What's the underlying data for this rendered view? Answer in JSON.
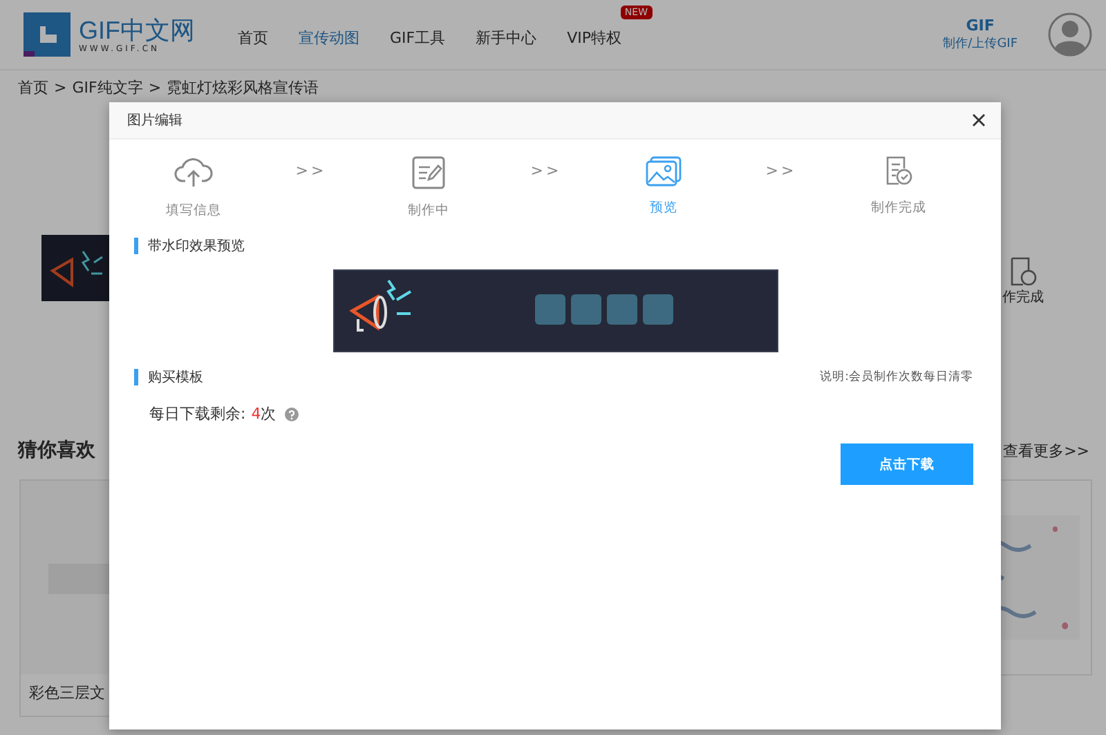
{
  "header": {
    "logo_text": "GIF中文网",
    "logo_sub": "WWW.GIF.CN",
    "nav": [
      {
        "label": "首页",
        "selected": false
      },
      {
        "label": "宣传动图",
        "selected": true
      },
      {
        "label": "GIF工具",
        "selected": false
      },
      {
        "label": "新手中心",
        "selected": false
      },
      {
        "label": "VIP特权",
        "selected": false,
        "badge": "NEW"
      }
    ],
    "upload": {
      "title": "GIF",
      "label": "制作/上传GIF"
    }
  },
  "breadcrumb": [
    {
      "label": "首页",
      "sep": ">"
    },
    {
      "label": "GIF纯文字",
      "sep": ">"
    },
    {
      "label": "霓虹灯炫彩风格宣传语"
    }
  ],
  "background_step": "作完成",
  "recommend": {
    "title": "猜你喜欢",
    "more": "查看更多>>",
    "caption": "彩色三层文"
  },
  "modal": {
    "title": "图片编辑",
    "steps": [
      {
        "kind": "upload",
        "label": "填写信息",
        "selected": false
      },
      {
        "kind": "edit",
        "label": "制作中",
        "selected": false,
        "before": ">>"
      },
      {
        "kind": "preview",
        "label": "预览",
        "selected": true,
        "before": ">>"
      },
      {
        "kind": "done",
        "label": "制作完成",
        "selected": false,
        "before": ">>"
      }
    ],
    "preview_heading": "带水印效果预览",
    "buy_heading": "购买模板",
    "note": "说明:会员制作次数每日清零",
    "remaining": {
      "label": "每日下载剩余:",
      "count": "4",
      "unit": "次"
    },
    "button": "点击下载"
  }
}
